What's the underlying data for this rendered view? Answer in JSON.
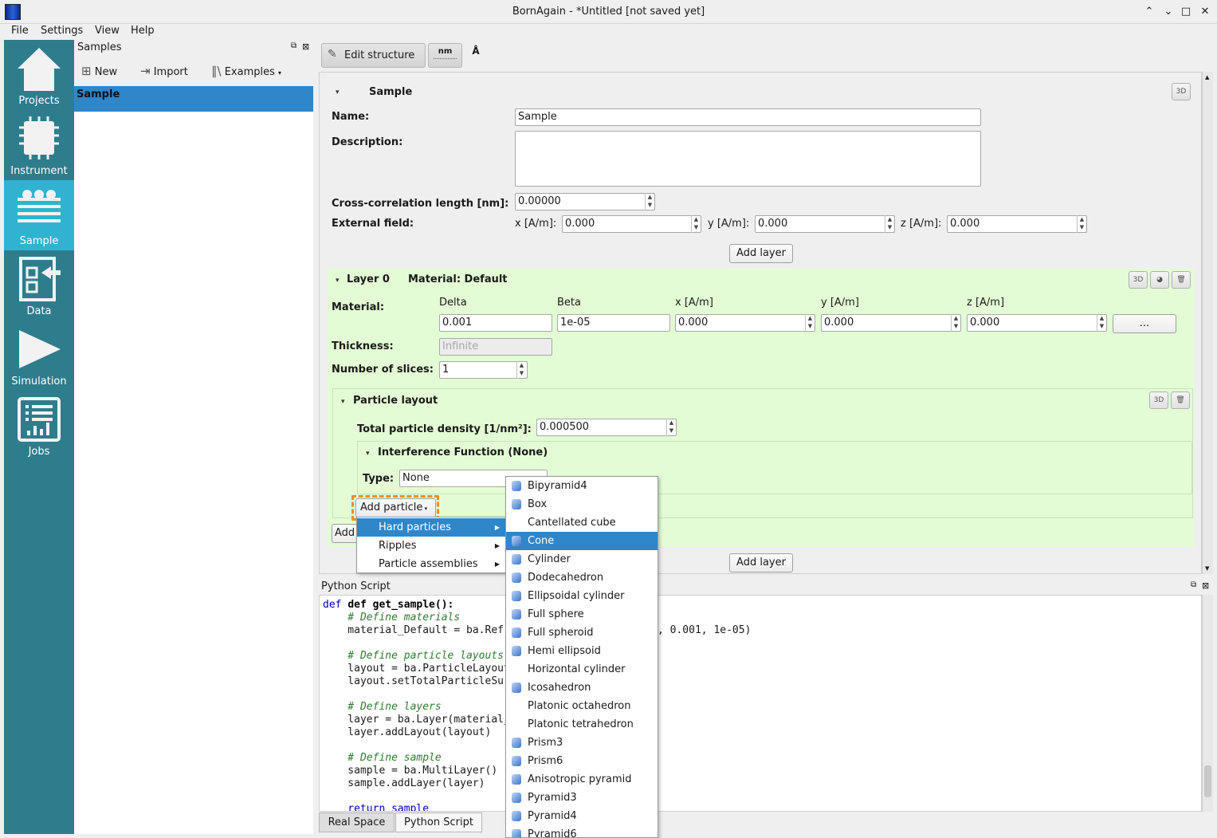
{
  "window": {
    "title": "BornAgain - *Untitled [not saved yet]",
    "controls": [
      "⌃",
      "⌄",
      "□",
      "✕"
    ]
  },
  "menubar": [
    "File",
    "Settings",
    "View",
    "Help"
  ],
  "sidebar": {
    "items": [
      {
        "label": "Projects",
        "icon": "home-icon"
      },
      {
        "label": "Instrument",
        "icon": "chip-icon"
      },
      {
        "label": "Sample",
        "icon": "layers-icon",
        "active": true
      },
      {
        "label": "Data",
        "icon": "import-data-icon"
      },
      {
        "label": "Simulation",
        "icon": "play-icon"
      },
      {
        "label": "Jobs",
        "icon": "jobs-list-icon"
      }
    ],
    "active_color": "#2fb3d0",
    "base_color": "#2e7d8c"
  },
  "samples_panel": {
    "title": "Samples",
    "new_label": "New",
    "import_label": "Import",
    "examples_label": "Examples",
    "items": [
      "Sample"
    ],
    "selected_color": "#2f86c9"
  },
  "editor_toolbar": {
    "edit_structure": "Edit structure",
    "nm": "nm",
    "angstrom": "Å"
  },
  "sample": {
    "section_title": "Sample",
    "name_label": "Name:",
    "name_value": "Sample",
    "description_label": "Description:",
    "description_value": "",
    "cross_corr_label": "Cross-correlation length [nm]:",
    "cross_corr_value": "0.00000",
    "external_field_label": "External field:",
    "x_label": "x [A/m]:",
    "x_value": "0.000",
    "y_label": "y [A/m]:",
    "y_value": "0.000",
    "z_label": "z [A/m]:",
    "z_value": "0.000",
    "add_layer": "Add layer",
    "badge_3d": "3D"
  },
  "layer": {
    "title": "Layer 0",
    "material_title": "Material: Default",
    "material_label": "Material:",
    "cols": [
      "Delta",
      "Beta",
      "x [A/m]",
      "y [A/m]",
      "z [A/m]"
    ],
    "values": [
      "0.001",
      "1e-05",
      "0.000",
      "0.000",
      "0.000"
    ],
    "more_button": "...",
    "thickness_label": "Thickness:",
    "thickness_placeholder": "Infinite",
    "slices_label": "Number of slices:",
    "slices_value": "1",
    "bg_color": "#e3fcd5"
  },
  "particle_layout": {
    "title": "Particle layout",
    "density_label": "Total particle density [1/nm²]:",
    "density_value": "0.000500",
    "interference_title": "Interference Function (None)",
    "type_label": "Type:",
    "type_value": "None",
    "add_particle": "Add particle",
    "add_truncated": "Add",
    "add_layer": "Add layer"
  },
  "add_particle_menu": {
    "items": [
      {
        "label": "Hard particles",
        "submenu": true,
        "selected": true
      },
      {
        "label": "Ripples",
        "submenu": true
      },
      {
        "label": "Particle assemblies",
        "submenu": true
      }
    ]
  },
  "hard_particles_menu": {
    "items": [
      {
        "label": "Bipyramid4",
        "icon": true
      },
      {
        "label": "Box",
        "icon": true
      },
      {
        "label": "Cantellated cube",
        "icon": false
      },
      {
        "label": "Cone",
        "icon": true,
        "selected": true
      },
      {
        "label": "Cylinder",
        "icon": true
      },
      {
        "label": "Dodecahedron",
        "icon": true
      },
      {
        "label": "Ellipsoidal cylinder",
        "icon": true
      },
      {
        "label": "Full sphere",
        "icon": true
      },
      {
        "label": "Full spheroid",
        "icon": true
      },
      {
        "label": "Hemi ellipsoid",
        "icon": true
      },
      {
        "label": "Horizontal cylinder",
        "icon": false
      },
      {
        "label": "Icosahedron",
        "icon": true
      },
      {
        "label": "Platonic octahedron",
        "icon": false
      },
      {
        "label": "Platonic tetrahedron",
        "icon": false
      },
      {
        "label": "Prism3",
        "icon": true
      },
      {
        "label": "Prism6",
        "icon": true
      },
      {
        "label": "Anisotropic pyramid",
        "icon": true
      },
      {
        "label": "Pyramid3",
        "icon": true
      },
      {
        "label": "Pyramid4",
        "icon": true
      },
      {
        "label": "Pyramid6",
        "icon": true
      }
    ]
  },
  "python_panel": {
    "title": "Python Script",
    "lines": [
      "def get_sample():",
      "    # Define materials",
      "    material_Default = ba.Refr",
      "",
      "    # Define particle layouts",
      "    layout = ba.ParticleLayout",
      "    layout.setTotalParticleSur",
      "",
      "    # Define layers",
      "    layer = ba.Layer(material_",
      "    layer.addLayout(layout)",
      "",
      "    # Define sample",
      "    sample = ba.MultiLayer()",
      "    sample.addLayer(layer)",
      "",
      "    return sample"
    ],
    "line3_tail": ", 0.001, 1e-05)"
  },
  "bottom_tabs": [
    "Real Space",
    "Python Script"
  ]
}
